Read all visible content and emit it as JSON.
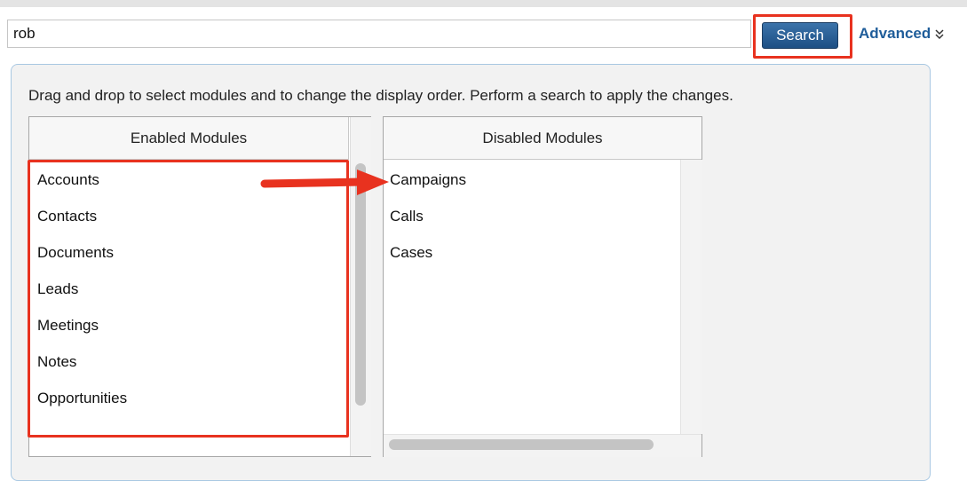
{
  "search": {
    "value": "rob",
    "button_label": "Search",
    "advanced_label": "Advanced",
    "advanced_icon": "double-chevron-down-icon"
  },
  "panel": {
    "instructions": "Drag and drop to select modules and to change the display order. Perform a search to apply the changes."
  },
  "enabled_modules": {
    "header": "Enabled Modules",
    "items": [
      "Accounts",
      "Contacts",
      "Documents",
      "Leads",
      "Meetings",
      "Notes",
      "Opportunities"
    ]
  },
  "disabled_modules": {
    "header": "Disabled Modules",
    "items": [
      "Campaigns",
      "Calls",
      "Cases"
    ]
  },
  "annotations": {
    "highlight_color": "#e8321f",
    "arrow_color": "#e8321f",
    "arrow_icon": "right-arrow-icon"
  },
  "colors": {
    "search_button": "#1d4f84",
    "link": "#1f5d9a",
    "panel_border": "#a9c8e2"
  }
}
